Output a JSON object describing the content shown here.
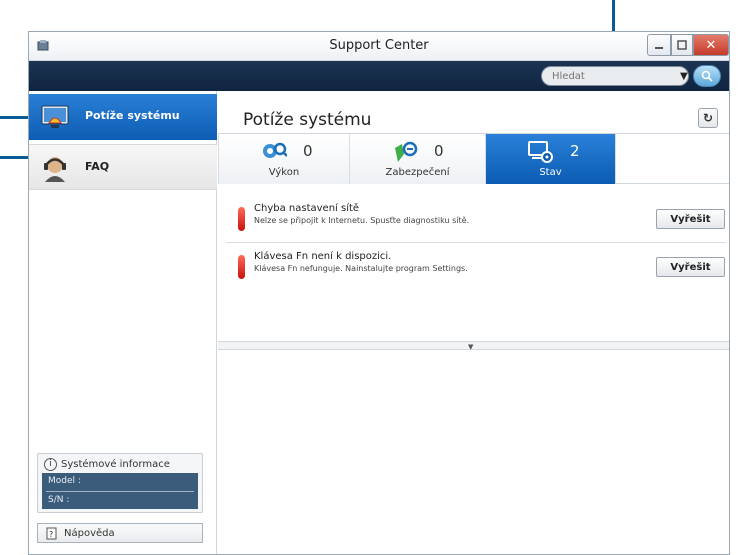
{
  "window": {
    "title": "Support Center"
  },
  "topbar": {
    "search_placeholder": "Hledat"
  },
  "sidebar": {
    "items": [
      {
        "label": "Potíže systému",
        "icon": "monitor-troubleshoot-icon",
        "active": true
      },
      {
        "label": "FAQ",
        "icon": "headset-agent-icon",
        "active": false
      }
    ],
    "sysinfo": {
      "heading": "Systémové informace",
      "model_label": "Model :",
      "sn_label": "S/N :"
    },
    "help_label": "Nápověda"
  },
  "main": {
    "title": "Potíže systému",
    "tabs": [
      {
        "label": "Výkon",
        "count": "0",
        "icon": "performance-gauge-icon"
      },
      {
        "label": "Zabezpečení",
        "count": "0",
        "icon": "security-icon"
      },
      {
        "label": "Stav",
        "count": "2",
        "icon": "status-settings-icon",
        "active": true
      }
    ],
    "issues": [
      {
        "title": "Chyba nastavení sítě",
        "description": "Nelze se připojit k Internetu. Spusťte diagnostiku sítě.",
        "button": "Vyřešit"
      },
      {
        "title": "Klávesa Fn není k dispozici.",
        "description": "Klávesa Fn nefunguje. Nainstalujte program Settings.",
        "button": "Vyřešit"
      }
    ]
  },
  "colors": {
    "accent": "#0d5db3",
    "topbar": "#142a47",
    "error": "#d4140c"
  }
}
